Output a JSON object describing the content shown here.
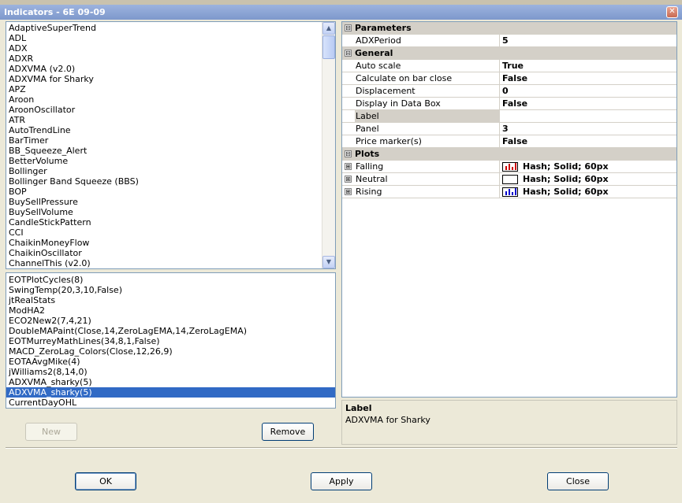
{
  "window": {
    "title": "Indicators - 6E 09-09",
    "close_glyph": "✕"
  },
  "available_list": {
    "items": [
      "AdaptiveSuperTrend",
      "ADL",
      "ADX",
      "ADXR",
      "ADXVMA (v2.0)",
      "ADXVMA for Sharky",
      "APZ",
      "Aroon",
      "AroonOscillator",
      "ATR",
      "AutoTrendLine",
      "BarTimer",
      "BB_Squeeze_Alert",
      "BetterVolume",
      "Bollinger",
      "Bollinger Band Squeeze (BBS)",
      "BOP",
      "BuySellPressure",
      "BuySellVolume",
      "CandleStickPattern",
      "CCI",
      "ChaikinMoneyFlow",
      "ChaikinOscillator",
      "ChannelThis (v2.0)"
    ]
  },
  "applied_list": {
    "items": [
      "EOTPlotCycles(8)",
      "SwingTemp(20,3,10,False)",
      "jtRealStats",
      "ModHA2",
      "ECO2New2(7,4,21)",
      "DoubleMAPaint(Close,14,ZeroLagEMA,14,ZeroLagEMA)",
      "EOTMurreyMathLines(34,8,1,False)",
      "MACD_ZeroLag_Colors(Close,12,26,9)",
      "EOTAAvgMike(4)",
      "jWilliams2(8,14,0)",
      "ADXVMA_sharky(5)",
      "ADXVMA_sharky(5)",
      "CurrentDayOHL"
    ],
    "selected_index": 11
  },
  "buttons": {
    "new": "New",
    "remove": "Remove",
    "ok": "OK",
    "apply": "Apply",
    "close": "Close"
  },
  "properties": {
    "parameters": {
      "title": "Parameters",
      "toggle": "⊟",
      "adx_period": {
        "name": "ADXPeriod",
        "value": "5"
      }
    },
    "general": {
      "title": "General",
      "toggle": "⊟",
      "auto_scale": {
        "name": "Auto scale",
        "value": "True"
      },
      "calc_on_close": {
        "name": "Calculate on bar close",
        "value": "False"
      },
      "displacement": {
        "name": "Displacement",
        "value": "0"
      },
      "display_in_data_box": {
        "name": "Display in Data Box",
        "value": "False"
      },
      "label": {
        "name": "Label",
        "value": ""
      },
      "panel": {
        "name": "Panel",
        "value": "3"
      },
      "price_markers": {
        "name": "Price marker(s)",
        "value": "False"
      }
    },
    "plots": {
      "title": "Plots",
      "toggle": "⊟",
      "falling": {
        "name": "Falling",
        "value": "Hash; Solid; 60px",
        "toggle": "⊞",
        "color": "#cc0000"
      },
      "neutral": {
        "name": "Neutral",
        "value": "Hash; Solid; 60px",
        "toggle": "⊞",
        "color": "#ffffff"
      },
      "rising": {
        "name": "Rising",
        "value": "Hash; Solid; 60px",
        "toggle": "⊞",
        "color": "#0000cc"
      }
    }
  },
  "description": {
    "title": "Label",
    "text": "ADXVMA for Sharky"
  },
  "icons": {
    "scroll_up": "▲",
    "scroll_down": "▼"
  }
}
